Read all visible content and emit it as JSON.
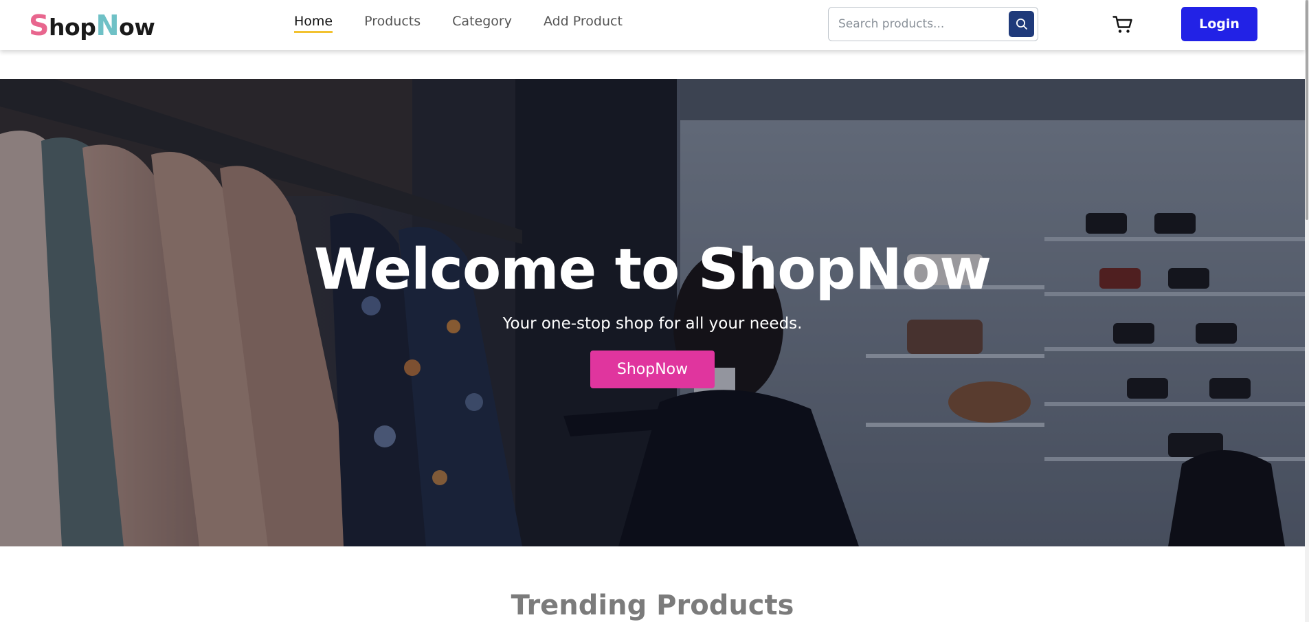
{
  "navbar": {
    "logo": {
      "s": "S",
      "hop": "hop",
      "n": "N",
      "ow": "ow"
    },
    "links": [
      {
        "label": "Home",
        "active": true
      },
      {
        "label": "Products",
        "active": false
      },
      {
        "label": "Category",
        "active": false
      },
      {
        "label": "Add Product",
        "active": false
      }
    ],
    "search": {
      "placeholder": "Search products...",
      "value": ""
    },
    "search_icon": "search-icon",
    "cart_icon": "cart-icon",
    "login_label": "Login"
  },
  "hero": {
    "title": "Welcome to ShopNow",
    "subtitle": "Your one-stop shop for all your needs.",
    "button_label": "ShopNow"
  },
  "trending": {
    "title": "Trending Products"
  },
  "colors": {
    "brand_pink": "#e8668e",
    "brand_teal": "#6fc1c6",
    "active_underline": "#f2c230",
    "search_button": "#1f3a7a",
    "login_button": "#2222e6",
    "hero_button": "#e0359e",
    "section_title": "#7b7b7b"
  }
}
